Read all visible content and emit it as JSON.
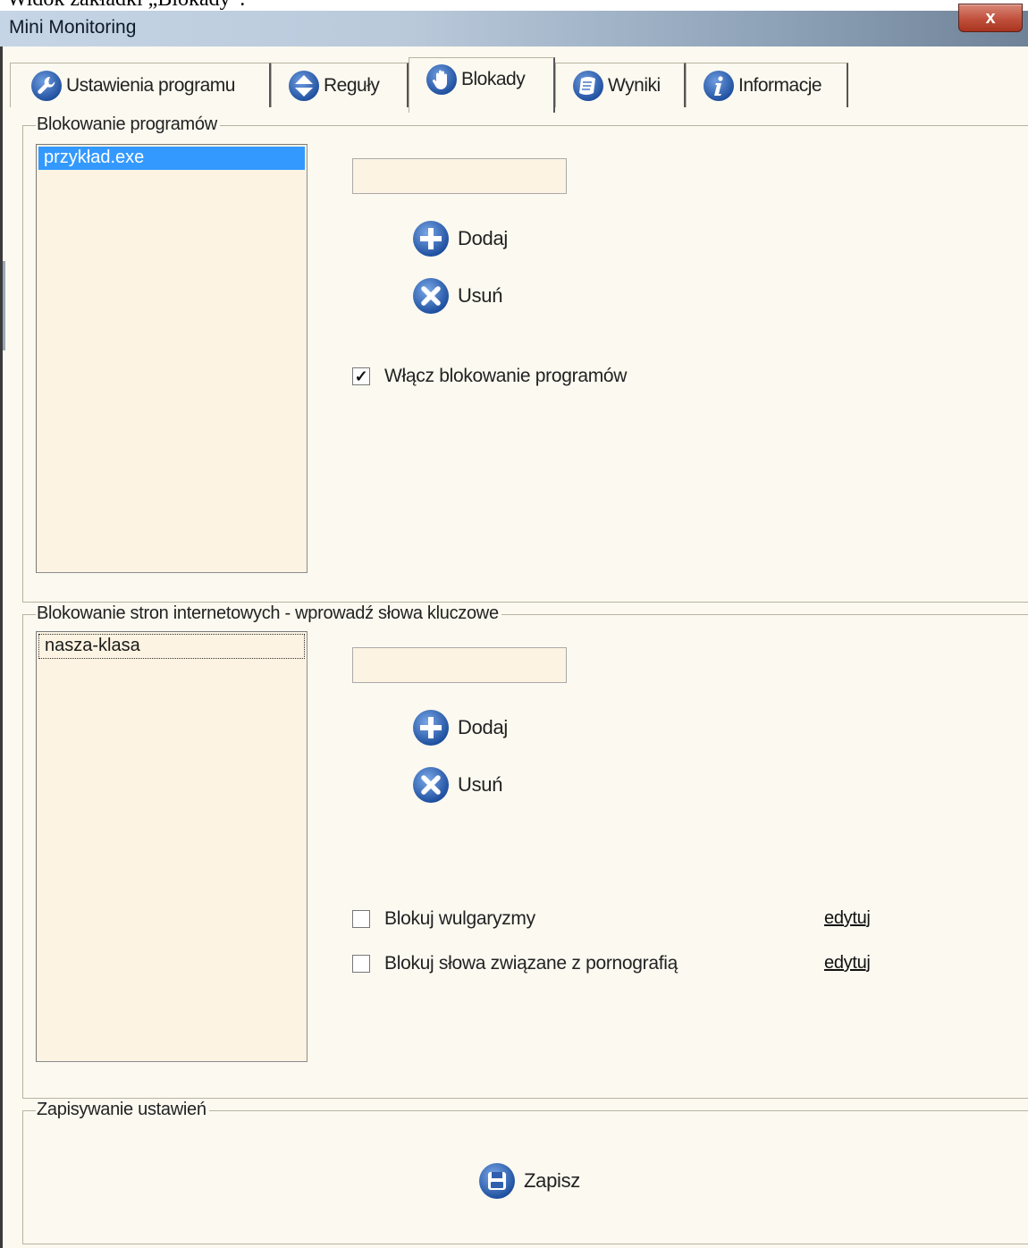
{
  "document": {
    "caption": "Widok zakładki „Blokady”."
  },
  "window": {
    "title": "Mini Monitoring",
    "close_label": "x"
  },
  "tabs": [
    {
      "label": "Ustawienia programu",
      "icon": "wrench-icon"
    },
    {
      "label": "Reguły",
      "icon": "up-down-arrows-icon"
    },
    {
      "label": "Blokady",
      "icon": "hand-stop-icon",
      "active": true
    },
    {
      "label": "Wyniki",
      "icon": "scroll-icon"
    },
    {
      "label": "Informacje",
      "icon": "info-icon"
    }
  ],
  "programs": {
    "group_title": "Blokowanie programów",
    "list": [
      "przykład.exe"
    ],
    "selected": "przykład.exe",
    "input_value": "",
    "add_label": "Dodaj",
    "remove_label": "Usuń",
    "enable_label": "Włącz blokowanie programów",
    "enable_checked": true
  },
  "websites": {
    "group_title": "Blokowanie stron internetowych - wprowadź słowa kluczowe",
    "list": [
      "nasza-klasa"
    ],
    "input_value": "",
    "add_label": "Dodaj",
    "remove_label": "Usuń",
    "options": [
      {
        "label": "Blokuj wulgaryzmy",
        "checked": false,
        "link": "edytuj"
      },
      {
        "label": "Blokuj słowa związane z pornografią",
        "checked": false,
        "link": "edytuj"
      }
    ]
  },
  "save": {
    "group_title": "Zapisywanie ustawień",
    "button_label": "Zapisz"
  },
  "colors": {
    "icon_blue": "#2f5fae",
    "selection": "#3399ff",
    "panel_bg": "#fbf9f0",
    "input_bg": "#fcf3e2"
  }
}
